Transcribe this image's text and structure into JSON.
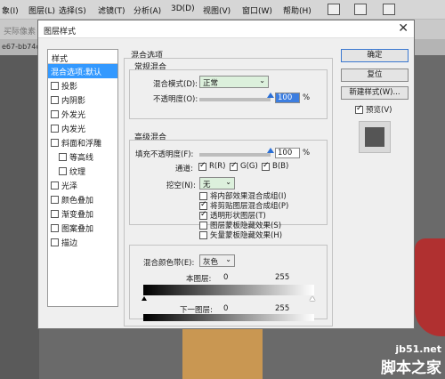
{
  "menubar": {
    "items": [
      "象(I)",
      "图层(L)",
      "选择(S)",
      "滤镜(T)",
      "分析(A)",
      "3D(D)",
      "视图(V)",
      "窗口(W)",
      "帮助(H)"
    ]
  },
  "toolbar": {
    "left_text": "买际像素"
  },
  "doc_tab": {
    "text": "e67-bb74c"
  },
  "watermark": {
    "line1": "jb51.net",
    "line2": "脚本之家"
  },
  "dialog": {
    "title": "图层样式",
    "close_glyph": "✕",
    "styles": {
      "header": "样式",
      "items": [
        {
          "label": "混合选项:默认",
          "checkbox": false,
          "selected": true,
          "indent": false
        },
        {
          "label": "投影",
          "checkbox": true,
          "checked": false,
          "indent": false
        },
        {
          "label": "内阴影",
          "checkbox": true,
          "checked": false,
          "indent": false
        },
        {
          "label": "外发光",
          "checkbox": true,
          "checked": false,
          "indent": false
        },
        {
          "label": "内发光",
          "checkbox": true,
          "checked": false,
          "indent": false
        },
        {
          "label": "斜面和浮雕",
          "checkbox": true,
          "checked": false,
          "indent": false
        },
        {
          "label": "等高线",
          "checkbox": true,
          "checked": false,
          "indent": true
        },
        {
          "label": "纹理",
          "checkbox": true,
          "checked": false,
          "indent": true
        },
        {
          "label": "光泽",
          "checkbox": true,
          "checked": false,
          "indent": false
        },
        {
          "label": "颜色叠加",
          "checkbox": true,
          "checked": false,
          "indent": false
        },
        {
          "label": "渐变叠加",
          "checkbox": true,
          "checked": false,
          "indent": false
        },
        {
          "label": "图案叠加",
          "checkbox": true,
          "checked": false,
          "indent": false
        },
        {
          "label": "描边",
          "checkbox": true,
          "checked": false,
          "indent": false
        }
      ]
    },
    "blend_options": {
      "title": "混合选项",
      "general": {
        "title": "常规混合",
        "mode_label": "混合模式(D):",
        "mode_value": "正常",
        "opacity_label": "不透明度(O):",
        "opacity_value": "100",
        "opacity_unit": "%",
        "opacity_level": 1.0
      },
      "advanced": {
        "title": "高级混合",
        "fill_label": "填充不透明度(F):",
        "fill_value": "100",
        "fill_unit": "%",
        "fill_level": 1.0,
        "channels_label": "通道:",
        "channels": [
          {
            "label": "R(R)",
            "checked": true
          },
          {
            "label": "G(G)",
            "checked": true
          },
          {
            "label": "B(B)",
            "checked": true
          }
        ],
        "knockout_label": "挖空(N):",
        "knockout_value": "无",
        "options": [
          {
            "label": "将内部效果混合成组(I)",
            "checked": false
          },
          {
            "label": "将剪贴图层混合成组(P)",
            "checked": true
          },
          {
            "label": "透明形状图层(T)",
            "checked": true
          },
          {
            "label": "图层蒙板隐藏效果(S)",
            "checked": false
          },
          {
            "label": "矢量蒙板隐藏效果(H)",
            "checked": false
          }
        ]
      },
      "blend_if": {
        "label": "混合颜色带(E):",
        "value": "灰色",
        "this_layer_label": "本图层:",
        "this_layer_low": "0",
        "this_layer_high": "255",
        "underlying_label": "下一图层:",
        "underlying_low": "0",
        "underlying_high": "255"
      }
    },
    "buttons": {
      "ok": "确定",
      "reset": "复位",
      "new_style": "新建样式(W)...",
      "preview_label": "预览(V)",
      "preview_checked": true
    }
  }
}
